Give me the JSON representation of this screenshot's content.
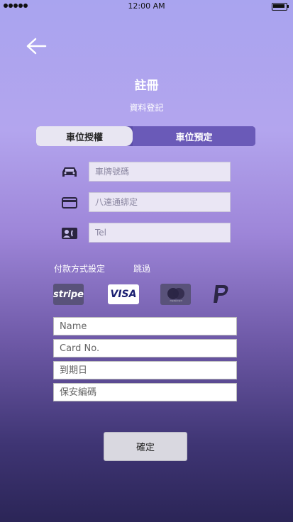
{
  "status_bar": {
    "time": "12:00 AM"
  },
  "header": {
    "title": "註冊",
    "subtitle": "資料登記"
  },
  "tabs": [
    {
      "label": "車位授權",
      "active": false
    },
    {
      "label": "車位預定",
      "active": true
    }
  ],
  "form": {
    "plate_placeholder": "車牌號碼",
    "octopus_placeholder": "八達通綁定",
    "tel_placeholder": "Tel"
  },
  "payment": {
    "label": "付款方式設定",
    "skip_label": "跳過",
    "methods": [
      "stripe",
      "VISA",
      "mastercard",
      "PayPal"
    ]
  },
  "card": {
    "name_placeholder": "Name",
    "number_placeholder": "Card No.",
    "expiry_placeholder": "到期日",
    "cvv_placeholder": "保安編碼"
  },
  "confirm_label": "確定",
  "colors": {
    "accent": "#6a5ab8",
    "segment_inactive": "#e8e6f2"
  }
}
